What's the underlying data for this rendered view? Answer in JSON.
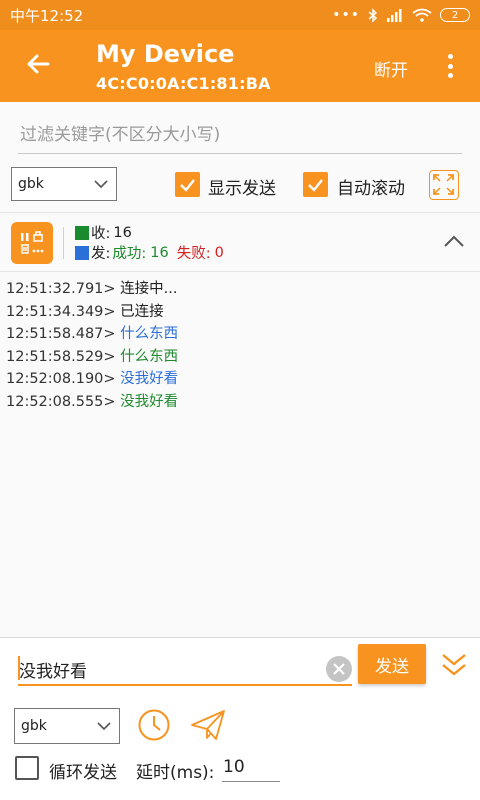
{
  "status_bar": {
    "time": "中午12:52",
    "battery": "2"
  },
  "app_bar": {
    "title": "My Device",
    "subtitle": "4C:C0:0A:C1:81:BA",
    "disconnect_label": "断开"
  },
  "filter": {
    "placeholder": "过滤关键字(不区分大小写)"
  },
  "top_controls": {
    "encoding": "gbk",
    "show_send_label": "显示发送",
    "show_send_checked": true,
    "auto_scroll_label": "自动滚动",
    "auto_scroll_checked": true
  },
  "stats": {
    "recv_label": "收:",
    "recv_count": "16",
    "send_label": "发:",
    "success_label": "成功:",
    "success_count": "16",
    "fail_label": "失败:",
    "fail_count": "0",
    "colors": {
      "recv": "#1a8a2e",
      "send": "#2b6fd8",
      "success": "#1f8a2e",
      "fail": "#d32020"
    }
  },
  "log": [
    {
      "time": "12:51:32.791>",
      "msg": "连接中...",
      "color": "black"
    },
    {
      "time": "12:51:34.349>",
      "msg": "已连接",
      "color": "black"
    },
    {
      "time": "12:51:58.487>",
      "msg": "什么东西",
      "color": "blue"
    },
    {
      "time": "12:51:58.529>",
      "msg": "什么东西",
      "color": "green"
    },
    {
      "time": "12:52:08.190>",
      "msg": "没我好看",
      "color": "blue"
    },
    {
      "time": "12:52:08.555>",
      "msg": "没我好看",
      "color": "green"
    }
  ],
  "send": {
    "input_value": "没我好看",
    "button_label": "发送"
  },
  "bottom_controls": {
    "encoding": "gbk",
    "loop_label": "循环发送",
    "loop_checked": false,
    "delay_label": "延时(ms):",
    "delay_value": "10"
  },
  "theme": {
    "accent": "#f7931e",
    "status_bar": "#ef8d1d"
  }
}
